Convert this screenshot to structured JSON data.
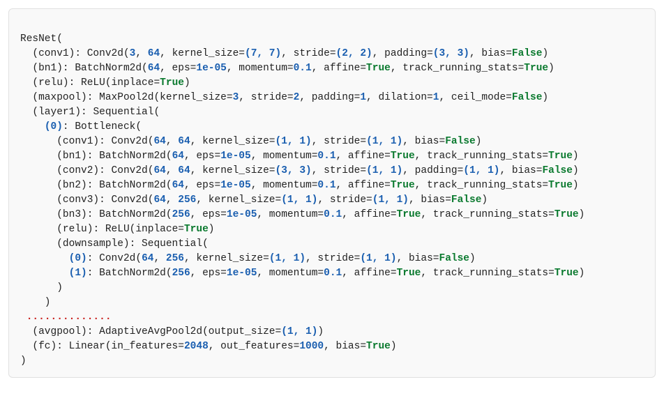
{
  "class_name": "ResNet",
  "conv1": {
    "label": "(conv1)",
    "type": "Conv2d",
    "in_ch": "3",
    "out_ch": "64",
    "ks": "(7, 7)",
    "stride": "(2, 2)",
    "pad": "(3, 3)",
    "bias": "False"
  },
  "bn1": {
    "label": "(bn1)",
    "type": "BatchNorm2d",
    "nf": "64",
    "eps": "1e-05",
    "momentum": "0.1",
    "affine": "True",
    "trs": "True"
  },
  "relu": {
    "label": "(relu)",
    "type": "ReLU",
    "inplace": "True"
  },
  "maxpool": {
    "label": "(maxpool)",
    "type": "MaxPool2d",
    "ks": "3",
    "stride": "2",
    "pad": "1",
    "dilation": "1",
    "ceil": "False"
  },
  "layer1": {
    "label": "(layer1)",
    "type": "Sequential",
    "b0": {
      "label": "(0)",
      "type": "Bottleneck",
      "conv1": {
        "label": "(conv1)",
        "type": "Conv2d",
        "in": "64",
        "out": "64",
        "ks": "(1, 1)",
        "st": "(1, 1)",
        "bias": "False"
      },
      "bn1": {
        "label": "(bn1)",
        "type": "BatchNorm2d",
        "nf": "64",
        "eps": "1e-05",
        "mom": "0.1",
        "aff": "True",
        "trs": "True"
      },
      "conv2": {
        "label": "(conv2)",
        "type": "Conv2d",
        "in": "64",
        "out": "64",
        "ks": "(3, 3)",
        "st": "(1, 1)",
        "pad": "(1, 1)",
        "bias": "False"
      },
      "bn2": {
        "label": "(bn2)",
        "type": "BatchNorm2d",
        "nf": "64",
        "eps": "1e-05",
        "mom": "0.1",
        "aff": "True",
        "trs": "True"
      },
      "conv3": {
        "label": "(conv3)",
        "type": "Conv2d",
        "in": "64",
        "out": "256",
        "ks": "(1, 1)",
        "st": "(1, 1)",
        "bias": "False"
      },
      "bn3": {
        "label": "(bn3)",
        "type": "BatchNorm2d",
        "nf": "256",
        "eps": "1e-05",
        "mom": "0.1",
        "aff": "True",
        "trs": "True"
      },
      "relu": {
        "label": "(relu)",
        "type": "ReLU",
        "inplace": "True"
      },
      "down": {
        "label": "(downsample)",
        "type": "Sequential",
        "d0": {
          "label": "(0)",
          "type": "Conv2d",
          "in": "64",
          "out": "256",
          "ks": "(1, 1)",
          "st": "(1, 1)",
          "bias": "False"
        },
        "d1": {
          "label": "(1)",
          "type": "BatchNorm2d",
          "nf": "256",
          "eps": "1e-05",
          "mom": "0.1",
          "aff": "True",
          "trs": "True"
        }
      }
    }
  },
  "ellipsis": "..............",
  "avgpool": {
    "label": "(avgpool)",
    "type": "AdaptiveAvgPool2d",
    "out": "(1, 1)"
  },
  "fc": {
    "label": "(fc)",
    "type": "Linear",
    "in": "2048",
    "out": "1000",
    "bias": "True"
  },
  "close": ")"
}
